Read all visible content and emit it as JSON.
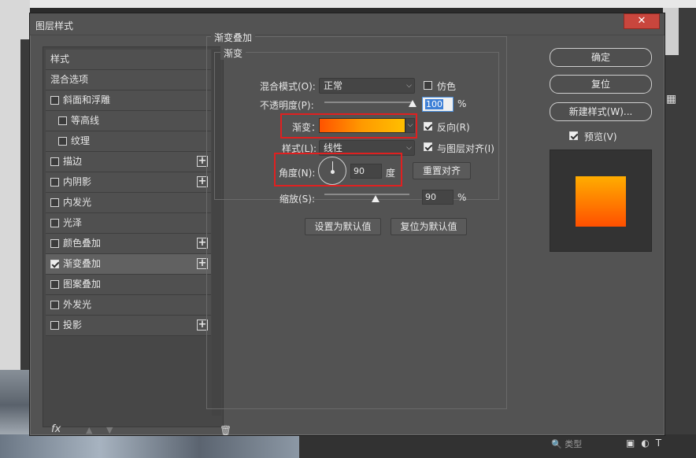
{
  "dialog": {
    "title": "图层样式",
    "close_label": "✕"
  },
  "left_panel": {
    "items": [
      {
        "label": "样式",
        "checkbox": false,
        "checked": false,
        "plus": false
      },
      {
        "label": "混合选项",
        "checkbox": false,
        "checked": false,
        "plus": false
      },
      {
        "label": "斜面和浮雕",
        "checkbox": true,
        "checked": false,
        "plus": false
      },
      {
        "label": "等高线",
        "checkbox": true,
        "checked": false,
        "plus": false,
        "indent": true
      },
      {
        "label": "纹理",
        "checkbox": true,
        "checked": false,
        "plus": false,
        "indent": true
      },
      {
        "label": "描边",
        "checkbox": true,
        "checked": false,
        "plus": true
      },
      {
        "label": "内阴影",
        "checkbox": true,
        "checked": false,
        "plus": true
      },
      {
        "label": "内发光",
        "checkbox": true,
        "checked": false,
        "plus": false
      },
      {
        "label": "光泽",
        "checkbox": true,
        "checked": false,
        "plus": false
      },
      {
        "label": "颜色叠加",
        "checkbox": true,
        "checked": false,
        "plus": true
      },
      {
        "label": "渐变叠加",
        "checkbox": true,
        "checked": true,
        "plus": true,
        "selected": true
      },
      {
        "label": "图案叠加",
        "checkbox": true,
        "checked": false,
        "plus": false
      },
      {
        "label": "外发光",
        "checkbox": true,
        "checked": false,
        "plus": false
      },
      {
        "label": "投影",
        "checkbox": true,
        "checked": false,
        "plus": true
      }
    ],
    "fx_label": "fx",
    "up_icon": "▲",
    "down_icon": "▼",
    "trash_icon": "🗑"
  },
  "gradient_overlay": {
    "group_title": "渐变叠加",
    "subgroup_title": "渐变",
    "blend_mode_label": "混合模式(O):",
    "blend_mode_value": "正常",
    "dither_label": "仿色",
    "dither_checked": false,
    "opacity_label": "不透明度(P):",
    "opacity_value": "100",
    "opacity_unit": "%",
    "opacity_level": 100,
    "gradient_label": "渐变：",
    "gradient_colors": [
      "#ff5300",
      "#ff9a00",
      "#ffbf00"
    ],
    "reverse_label": "反向(R)",
    "reverse_checked": true,
    "style_label": "样式(L):",
    "style_value": "线性",
    "align_label": "与图层对齐(I)",
    "align_checked": true,
    "angle_label": "角度(N):",
    "angle_value": "90",
    "angle_unit": "度",
    "reset_align_label": "重置对齐",
    "scale_label": "缩放(S):",
    "scale_value": "90",
    "scale_unit": "%",
    "scale_level": 90,
    "set_default_label": "设置为默认值",
    "reset_default_label": "复位为默认值"
  },
  "right_panel": {
    "ok_label": "确定",
    "reset_label": "复位",
    "new_style_label": "新建样式(W)...",
    "preview_label": "预览(V)",
    "preview_checked": true
  },
  "background": {
    "search_placeholder": "类型"
  },
  "colors": {
    "dialog_bg": "#535353",
    "highlight_red": "#e02020",
    "selection_blue": "#3d7fd6"
  }
}
